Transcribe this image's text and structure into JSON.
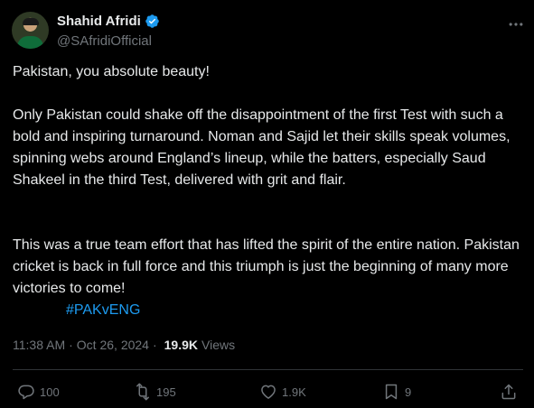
{
  "author": {
    "name": "Shahid Afridi",
    "handle": "@SAfridiOfficial"
  },
  "tweet": {
    "paragraph1": "Pakistan, you absolute beauty!",
    "paragraph2": "Only Pakistan could shake off the disappointment of the first Test with such a bold and inspiring turnaround. Noman and Sajid let their skills speak volumes, spinning webs around England’s lineup, while the batters, especially Saud Shakeel in the third Test, delivered with grit and flair.",
    "paragraph3": "This was a true team effort that has lifted the spirit of the entire nation. Pakistan cricket is back in full force and this triumph is just the beginning of many more victories to come!",
    "hashtag": "#PAKvENG"
  },
  "meta": {
    "time": "11:38 AM",
    "separator": "·",
    "date": "Oct 26, 2024",
    "views_count": "19.9K",
    "views_label": "Views"
  },
  "actions": {
    "replies": "100",
    "reposts": "195",
    "likes": "1.9K",
    "bookmarks": "9"
  },
  "colors": {
    "background": "#000000",
    "text": "#e7e9ea",
    "secondary": "#71767b",
    "accent": "#1d9bf0",
    "divider": "#2f3336"
  },
  "icons": [
    "verified-badge-icon",
    "more-icon",
    "reply-icon",
    "repost-icon",
    "like-icon",
    "bookmark-icon",
    "share-icon"
  ]
}
